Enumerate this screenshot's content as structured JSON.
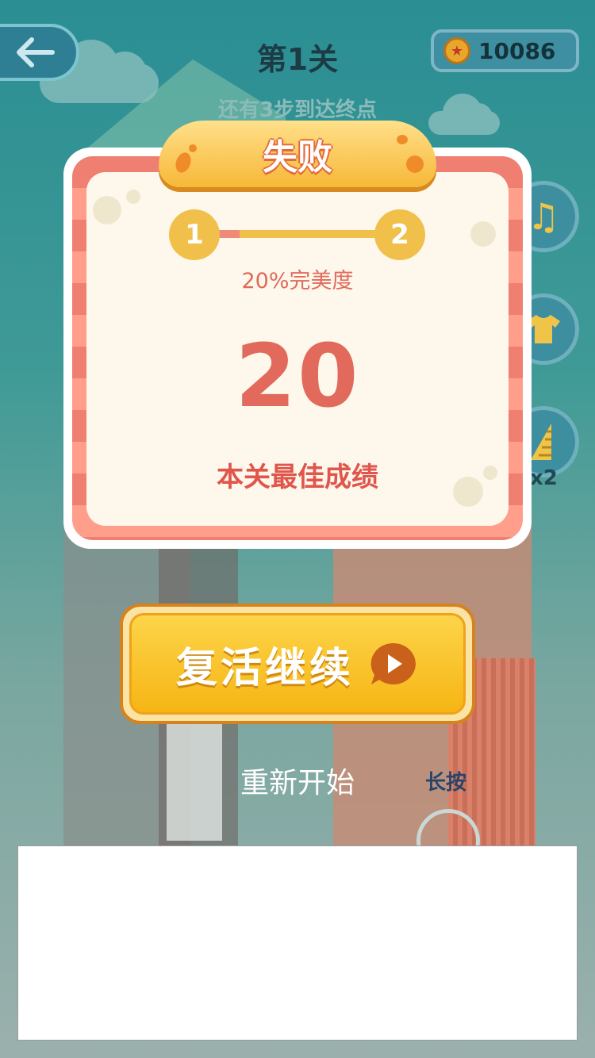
{
  "header": {
    "back_icon": "arrow-left-icon",
    "level_title": "第1关",
    "coin_icon": "coin-star-icon",
    "coins": "10086",
    "steps_hint": "还有3步到达终点"
  },
  "side_buttons": {
    "music_icon": "music-note-icon",
    "shirt_icon": "shirt-icon",
    "ruler_icon": "ruler-icon",
    "multiplier": "x2"
  },
  "dialog": {
    "title": "失败",
    "progress": {
      "start_node": "1",
      "end_node": "2",
      "fill_fraction": 0.2
    },
    "perfection_label": "20%完美度",
    "score": "20",
    "best_label": "本关最佳成绩"
  },
  "actions": {
    "revive_label": "复活继续",
    "play_icon": "play-bubble-icon",
    "restart_label": "重新开始",
    "long_press_label": "长按"
  },
  "colors": {
    "accent_red": "#e26a5c",
    "button_yellow": "#f6b514",
    "node_yellow": "#f0c04a"
  }
}
